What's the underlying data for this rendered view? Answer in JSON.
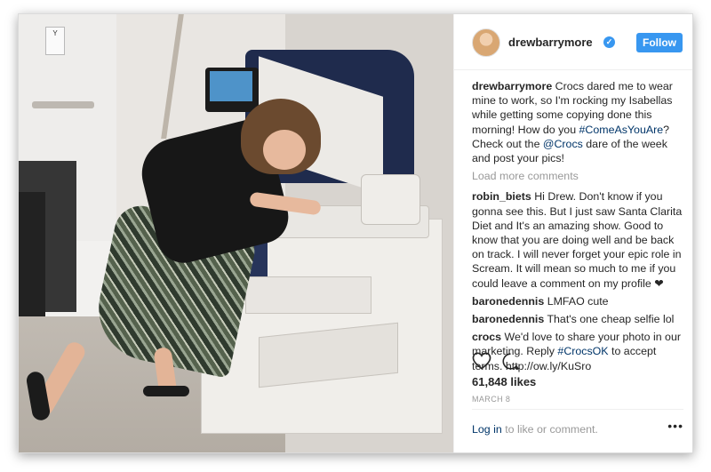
{
  "post": {
    "username": "drewbarrymore",
    "verified_glyph": "✓",
    "follow_label": "Follow",
    "accent_color": "#3897f0",
    "link_color": "#003569",
    "caption": {
      "username": "drewbarrymore",
      "text_1": "Crocs dared me to wear mine to work, so I'm rocking my Isabellas while getting some copying done this morning! How do you ",
      "hashtag": "#ComeAsYouAre",
      "text_2": "? Check out the ",
      "mention": "@Crocs",
      "text_3": " dare of the week and post your pics!"
    },
    "load_more": "Load more comments",
    "comments": [
      {
        "username": "robin_biets",
        "text": "Hi Drew. Don't know if you gonna see this. But I just saw Santa Clarita Diet and It's an amazing show. Good to know that you are doing well and be back on track. I will never forget your epic role in Scream. It will mean so much to me if you could leave a comment on my profile ❤"
      },
      {
        "username": "baronedennis",
        "text": "LMFAO cute"
      },
      {
        "username": "baronedennis",
        "text": "That's one cheap selfie lol"
      }
    ],
    "crocs_comment": {
      "username": "crocs",
      "text_1": "We'd love to share your photo in our marketing. Reply ",
      "hashtag": "#CrocsOK",
      "text_2": " to accept terms. http://ow.ly/KuSro"
    },
    "likes": "61,848 likes",
    "date": "MARCH 8",
    "footer": {
      "login_link": "Log in",
      "login_rest": " to like or comment.",
      "more": "•••"
    },
    "sign_letter": "Y",
    "icons": [
      "heart-icon",
      "comment-icon",
      "more-options-icon",
      "verified-badge-icon"
    ]
  }
}
